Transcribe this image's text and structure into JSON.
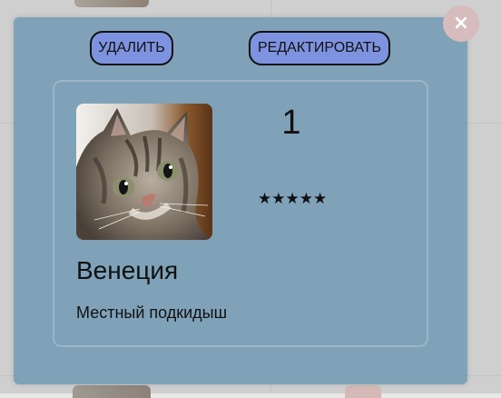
{
  "modal": {
    "delete_label": "УДАЛИТЬ",
    "edit_label": "РЕДАКТИРОВАТЬ",
    "close_glyph": "×"
  },
  "card": {
    "count": "1",
    "rating_stars": "★★★★★",
    "name": "Венеция",
    "description": "Местный подкидыш"
  },
  "colors": {
    "modal_bg": "#7fa2b9",
    "button_bg": "#7e93df",
    "close_bg": "#d6bcbc"
  }
}
